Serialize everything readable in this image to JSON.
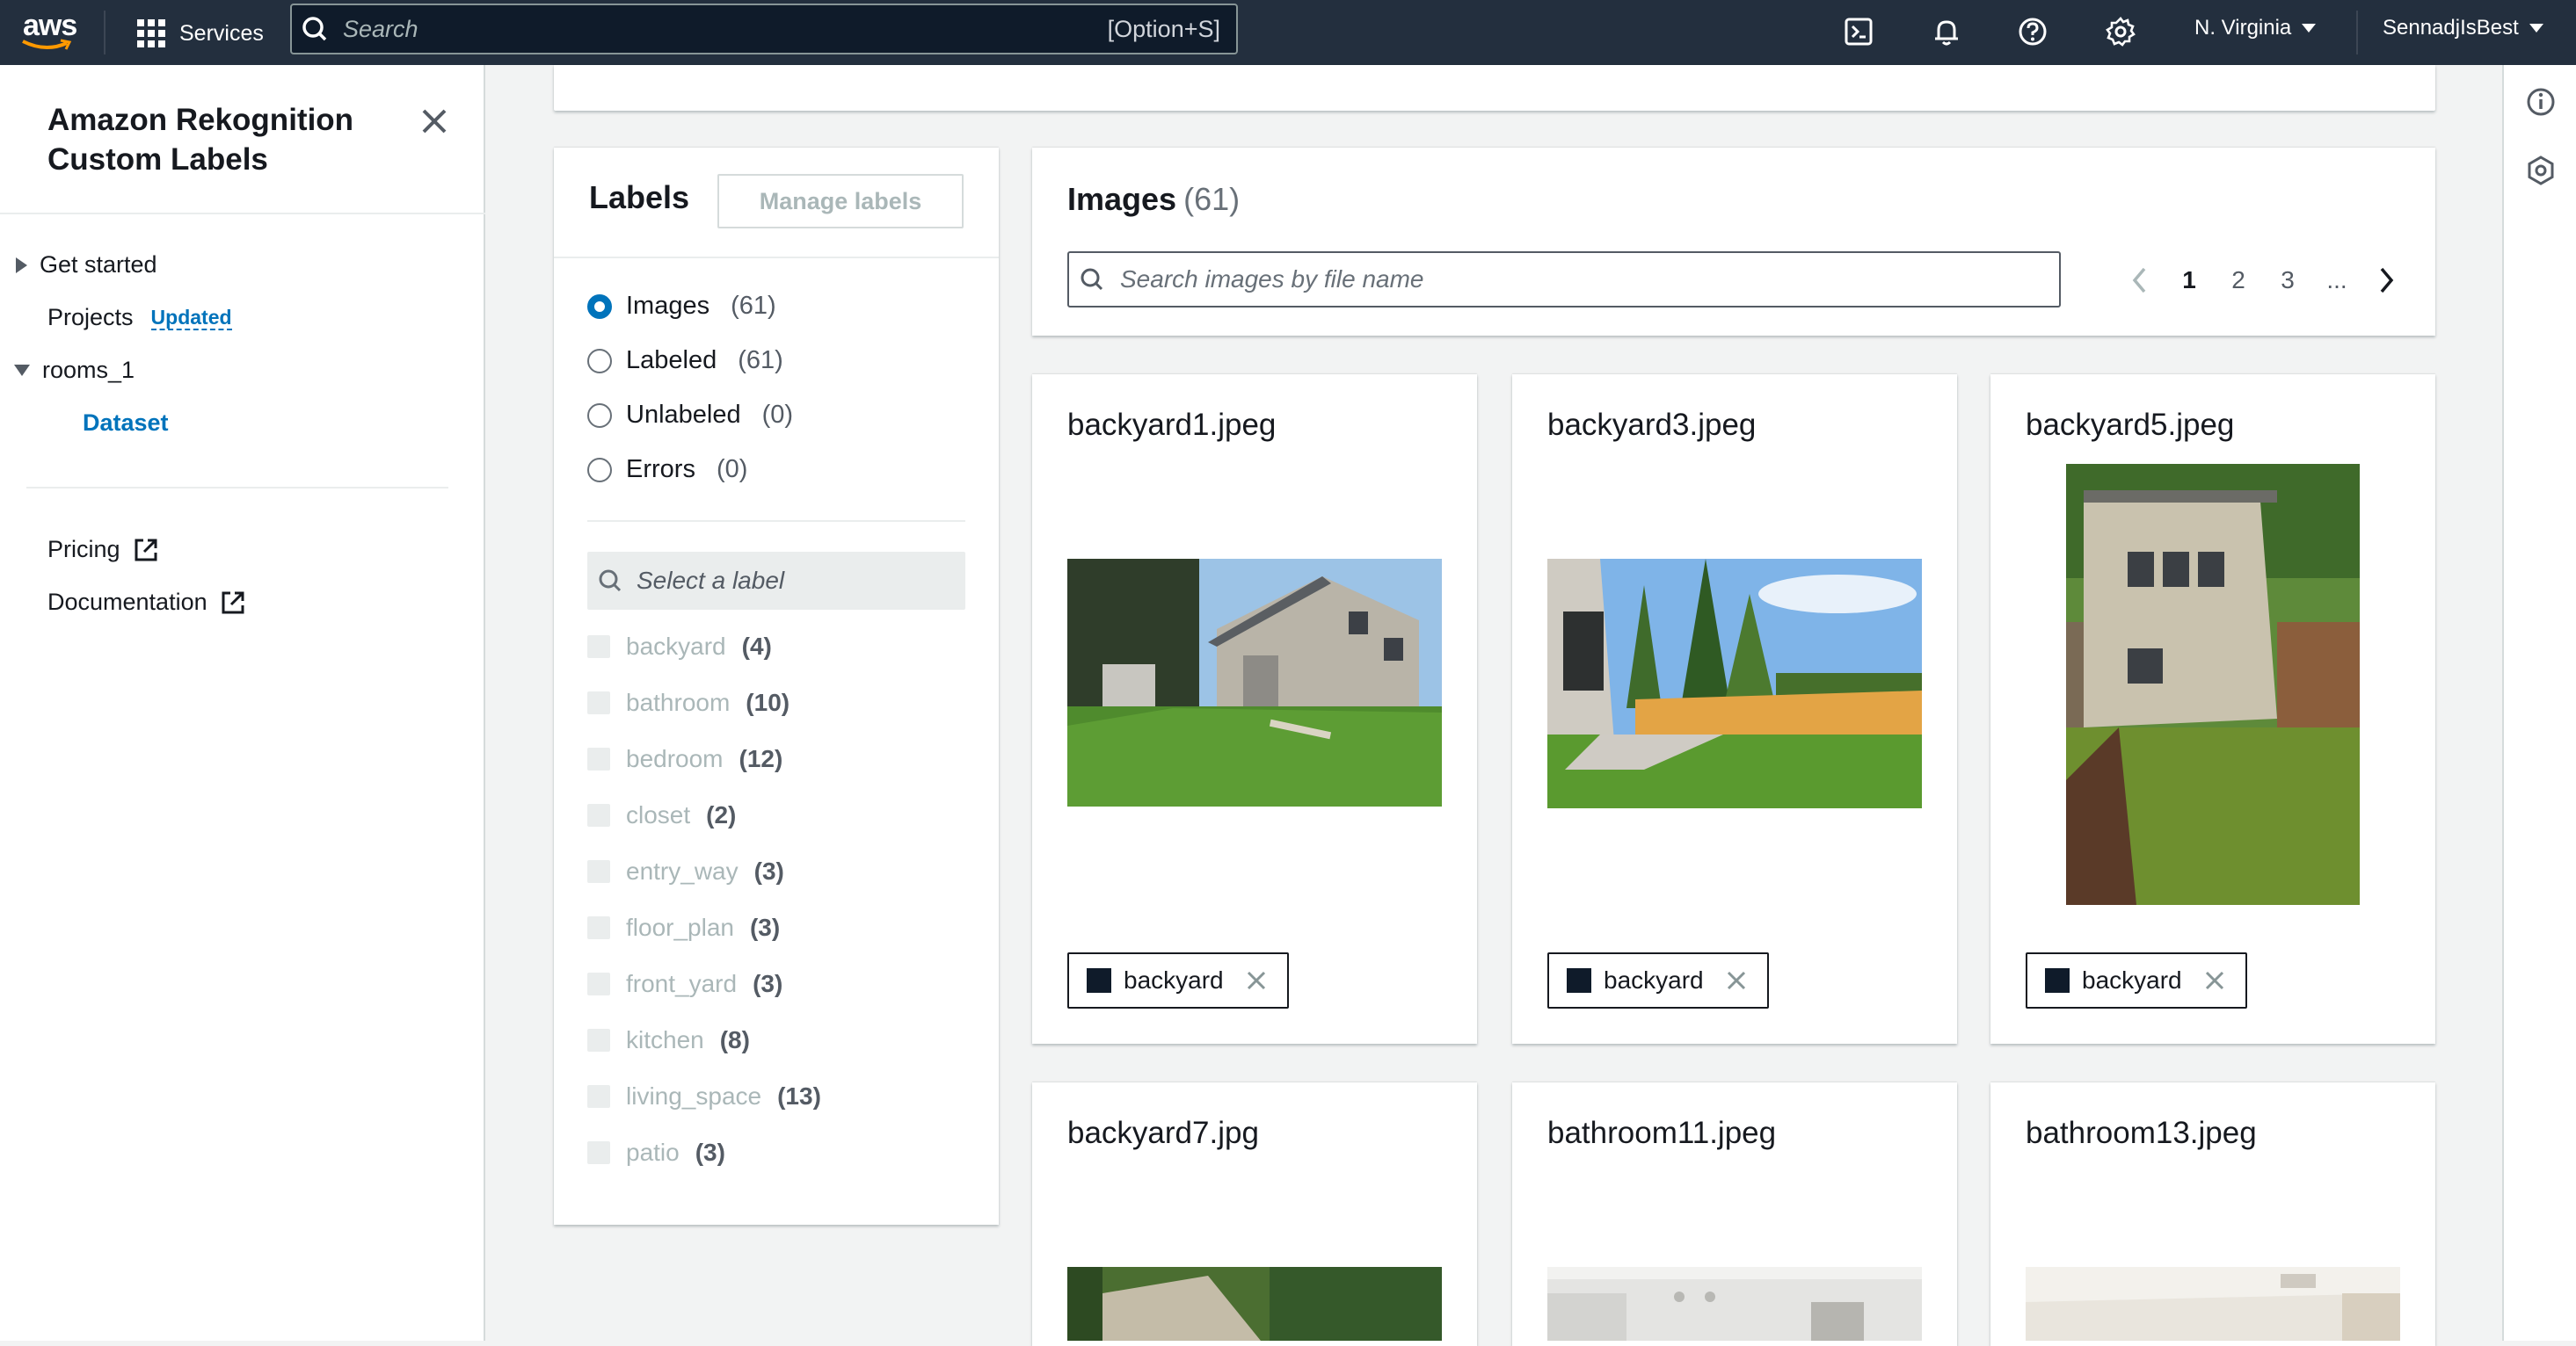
{
  "topnav": {
    "logo_text": "aws",
    "services_label": "Services",
    "search_placeholder": "Search",
    "search_shortcut": "[Option+S]",
    "region": "N. Virginia",
    "account": "SennadjIsBest",
    "icons": [
      "cloudshell-icon",
      "bell-icon",
      "help-icon",
      "settings-icon"
    ]
  },
  "sidebar": {
    "title": "Amazon Rekognition Custom Labels",
    "items": [
      {
        "label": "Get started",
        "expandable": true,
        "expanded": false
      },
      {
        "label": "Projects",
        "badge": "Updated"
      },
      {
        "label": "rooms_1",
        "expandable": true,
        "expanded": true
      },
      {
        "label": "Dataset",
        "active": true
      },
      {
        "label": "Pricing",
        "external": true
      },
      {
        "label": "Documentation",
        "external": true
      }
    ]
  },
  "labels_panel": {
    "title": "Labels",
    "manage_button": "Manage labels",
    "filters": [
      {
        "label": "Images",
        "count": "(61)",
        "selected": true
      },
      {
        "label": "Labeled",
        "count": "(61)",
        "selected": false
      },
      {
        "label": "Unlabeled",
        "count": "(0)",
        "selected": false
      },
      {
        "label": "Errors",
        "count": "(0)",
        "selected": false
      }
    ],
    "label_search_placeholder": "Select a label",
    "labels": [
      {
        "name": "backyard",
        "count": "(4)"
      },
      {
        "name": "bathroom",
        "count": "(10)"
      },
      {
        "name": "bedroom",
        "count": "(12)"
      },
      {
        "name": "closet",
        "count": "(2)"
      },
      {
        "name": "entry_way",
        "count": "(3)"
      },
      {
        "name": "floor_plan",
        "count": "(3)"
      },
      {
        "name": "front_yard",
        "count": "(3)"
      },
      {
        "name": "kitchen",
        "count": "(8)"
      },
      {
        "name": "living_space",
        "count": "(13)"
      },
      {
        "name": "patio",
        "count": "(3)"
      }
    ]
  },
  "images_panel": {
    "title": "Images",
    "count": "(61)",
    "search_placeholder": "Search images by file name",
    "pagination": {
      "pages": [
        "1",
        "2",
        "3",
        "..."
      ],
      "current": "1"
    }
  },
  "images": [
    {
      "file": "backyard1.jpeg",
      "label": "backyard"
    },
    {
      "file": "backyard3.jpeg",
      "label": "backyard"
    },
    {
      "file": "backyard5.jpeg",
      "label": "backyard"
    },
    {
      "file": "backyard7.jpg"
    },
    {
      "file": "bathroom11.jpeg"
    },
    {
      "file": "bathroom13.jpeg"
    }
  ],
  "colors": {
    "topbar": "#232f3e",
    "link": "#0073bb",
    "label_swatch": "#0f1b2a"
  }
}
